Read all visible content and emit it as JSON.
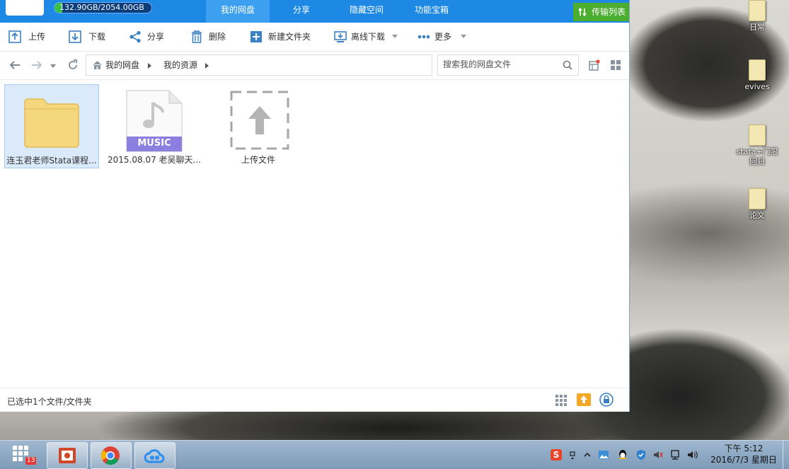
{
  "app": {
    "quota_text": "132.90GB/2054.00GB",
    "quota_fraction": 0.0647,
    "nav_tabs": [
      {
        "label": "我的网盘",
        "active": true
      },
      {
        "label": "分享",
        "active": false
      },
      {
        "label": "隐藏空间",
        "active": false
      },
      {
        "label": "功能宝箱",
        "active": false
      }
    ],
    "transfer_label": "传输列表"
  },
  "toolbar": {
    "upload": "上传",
    "download": "下载",
    "share": "分享",
    "delete": "删除",
    "new_folder": "新建文件夹",
    "offline_download": "离线下载",
    "more": "更多"
  },
  "address": {
    "crumbs": [
      "我的网盘",
      "我的资源"
    ],
    "search_placeholder": "搜索我的网盘文件"
  },
  "files": [
    {
      "name": "连玉君老师Stata课程...",
      "type": "folder",
      "selected": true
    },
    {
      "name": "2015.08.07 老吴聊天...",
      "type": "music",
      "badge": "MUSIC",
      "selected": false
    },
    {
      "name": "上传文件",
      "type": "upload",
      "selected": false
    }
  ],
  "status": {
    "text": "已选中1个文件/文件夹"
  },
  "desktop": {
    "icons": [
      "日常",
      "evives",
      "stata+门限回归",
      "论文"
    ]
  },
  "taskbar": {
    "start_badge": "13",
    "time": "下午 5:12",
    "date": "2016/7/3 星期日",
    "ime": "S"
  },
  "colors": {
    "topbar": "#1e88e5",
    "active_tab": "#3d9ff0",
    "transfer": "#4cae2f",
    "selection": "#dbeafb",
    "music_badge": "#8c7fe0"
  }
}
